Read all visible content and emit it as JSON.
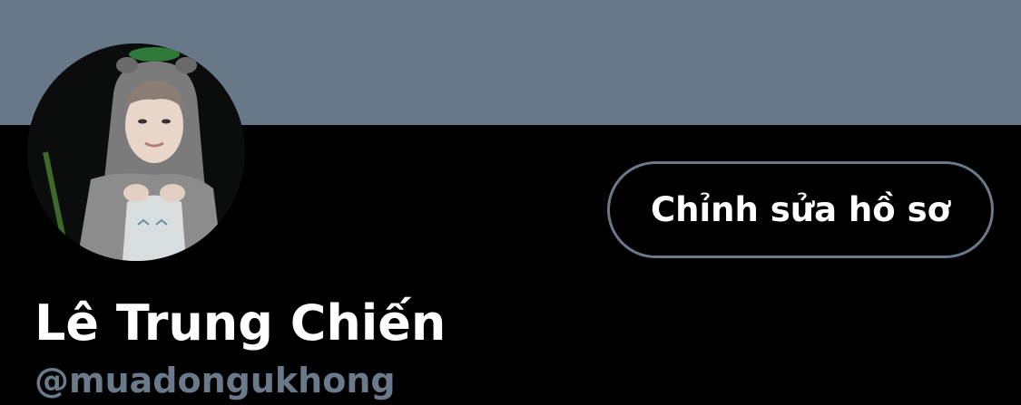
{
  "profile": {
    "banner_color": "#687888",
    "display_name": "Lê Trung Chiến",
    "handle": "@muadongukhong",
    "edit_button_label": "Chỉnh sửa hồ sơ",
    "accent_border_color": "#6b7a8a"
  },
  "icons": {
    "avatar": "profile-photo"
  }
}
